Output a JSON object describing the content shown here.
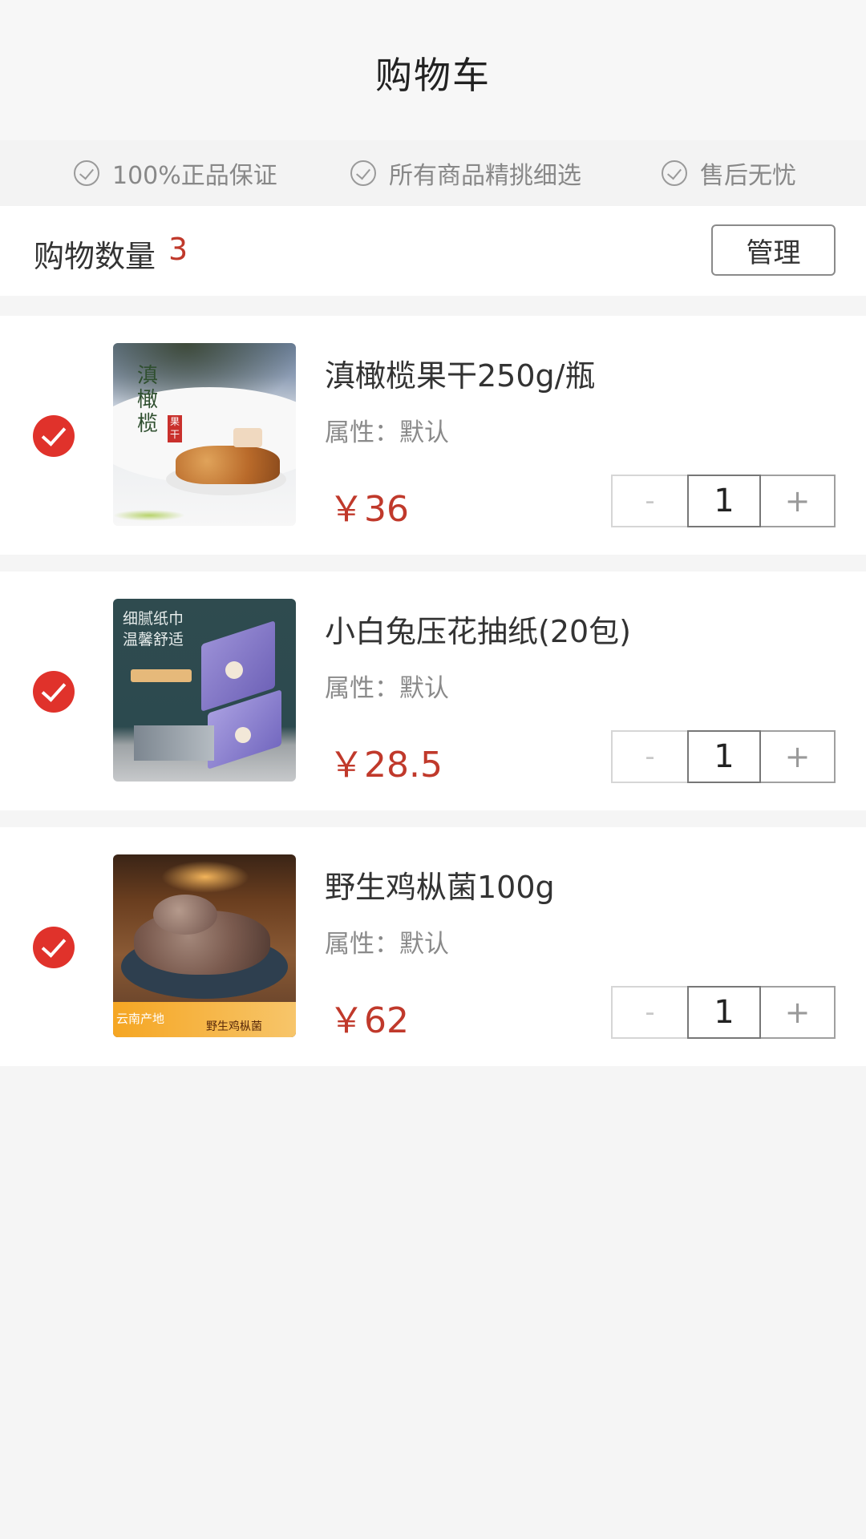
{
  "header": {
    "title": "购物车"
  },
  "guarantees": [
    {
      "icon": "check-circle-icon",
      "label": "100%正品保证"
    },
    {
      "icon": "check-circle-icon",
      "label": "所有商品精挑细选"
    },
    {
      "icon": "check-circle-icon",
      "label": "售后无忧"
    }
  ],
  "summary": {
    "label": "购物数量",
    "count": "3",
    "manage_label": "管理"
  },
  "items": [
    {
      "name": "滇橄榄果干250g/瓶",
      "attribute": "属性：默认",
      "price": "￥36",
      "quantity": "1",
      "minus_label": "-",
      "plus_label": "+",
      "selected": true,
      "image_text": [
        "滇",
        "橄",
        "榄"
      ],
      "image_stamp": "果干"
    },
    {
      "name": "小白兔压花抽纸(20包)",
      "attribute": "属性：默认",
      "price": "￥28.5",
      "quantity": "1",
      "minus_label": "-",
      "plus_label": "+",
      "selected": true,
      "image_text": [
        "细腻纸巾",
        "温馨舒适"
      ]
    },
    {
      "name": "野生鸡枞菌100g",
      "attribute": "属性：默认",
      "price": "￥62",
      "quantity": "1",
      "minus_label": "-",
      "plus_label": "+",
      "selected": true,
      "image_text": [
        "云南产地",
        "野生鸡枞菌"
      ]
    }
  ],
  "colors": {
    "accent": "#e0322b",
    "price": "#c0392b",
    "background": "#f5f5f5"
  }
}
